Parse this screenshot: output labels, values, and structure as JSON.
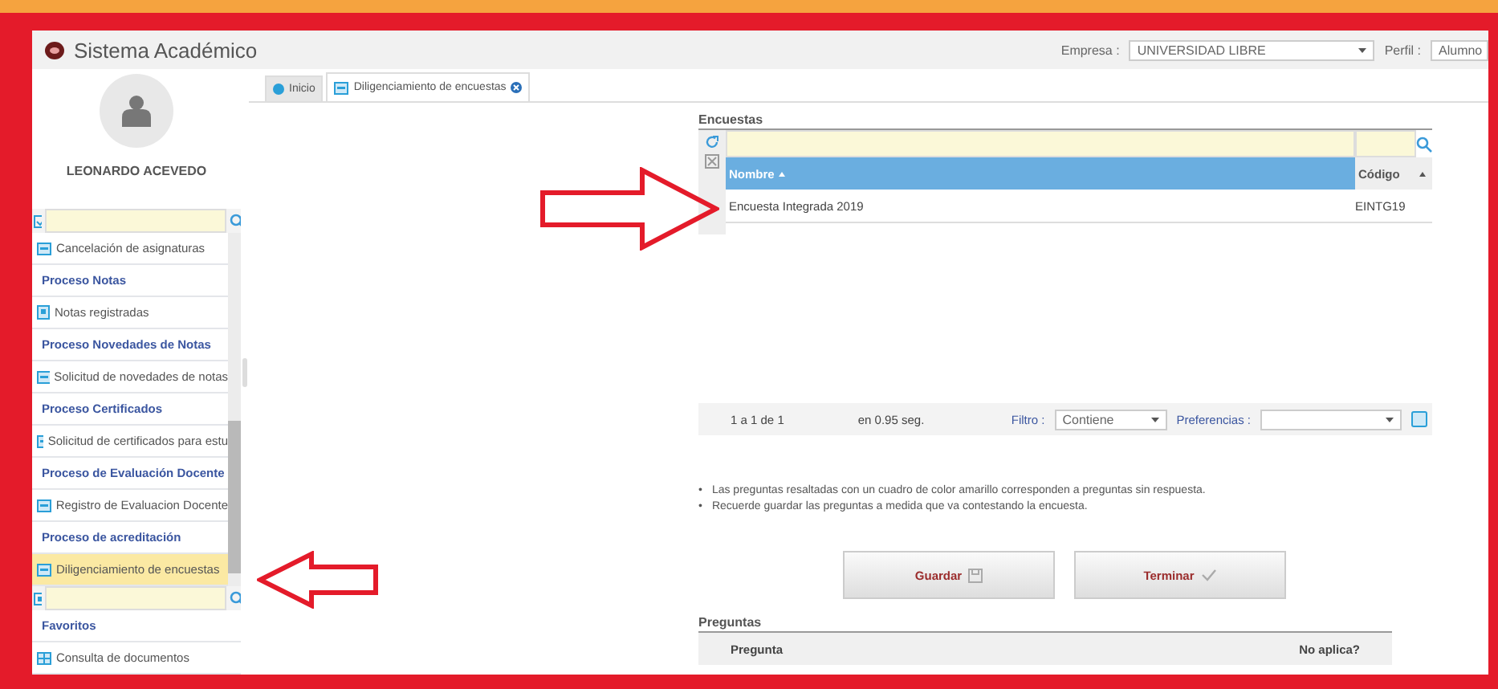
{
  "header": {
    "title": "Sistema Académico",
    "empresa_label": "Empresa :",
    "empresa_value": "UNIVERSIDAD LIBRE",
    "perfil_label": "Perfil :",
    "perfil_value": "Alumno"
  },
  "user": {
    "name": "LEONARDO ACEVEDO"
  },
  "menu": {
    "items": [
      {
        "label": "Cancelación de asignaturas",
        "kind": "link",
        "selected": false
      },
      {
        "label": "Proceso Notas",
        "kind": "section",
        "selected": false
      },
      {
        "label": "Notas registradas",
        "kind": "report",
        "selected": false
      },
      {
        "label": "Proceso Novedades de Notas",
        "kind": "section",
        "selected": false
      },
      {
        "label": "Solicitud de novedades de notas",
        "kind": "link",
        "selected": false
      },
      {
        "label": "Proceso Certificados",
        "kind": "section",
        "selected": false
      },
      {
        "label": "Solicitud de certificados para estu",
        "kind": "link",
        "selected": false
      },
      {
        "label": "Proceso de Evaluación Docente",
        "kind": "section",
        "selected": false
      },
      {
        "label": "Registro de Evaluacion Docente",
        "kind": "link",
        "selected": false
      },
      {
        "label": "Proceso de acreditación",
        "kind": "section",
        "selected": false
      },
      {
        "label": "Diligenciamiento de encuestas",
        "kind": "link",
        "selected": true
      }
    ]
  },
  "favorites": {
    "items": [
      {
        "label": "Favoritos",
        "kind": "section",
        "selected": false
      },
      {
        "label": "Consulta de documentos",
        "kind": "grid",
        "selected": false
      }
    ]
  },
  "tabs": [
    {
      "label": "Inicio",
      "kind": "home",
      "selected": false
    },
    {
      "label": "Diligenciamiento de encuestas",
      "kind": "form",
      "selected": true
    }
  ],
  "encuestas": {
    "title": "Encuestas",
    "columns": [
      {
        "label": "Nombre",
        "sorted": true
      },
      {
        "label": "Código",
        "sorted": false
      }
    ],
    "rows": [
      [
        "Encuesta Integrada 2019",
        "EINTG19"
      ]
    ],
    "pager": {
      "range": "1 a 1 de 1",
      "time": "en 0.95 seg.",
      "filter_label": "Filtro :",
      "filter_value": "Contiene",
      "prefs_label": "Preferencias :"
    }
  },
  "notes": [
    {
      "marker": "•",
      "text": "Las preguntas resaltadas con un cuadro de color amarillo corresponden a preguntas sin respuesta."
    },
    {
      "marker": "•",
      "text": "Recuerde guardar las preguntas a medida que va contestando la encuesta."
    }
  ],
  "buttons": [
    {
      "label": "Guardar",
      "kind": "save"
    },
    {
      "label": "Terminar",
      "kind": "finish"
    }
  ],
  "preguntas": {
    "title": "Preguntas",
    "columns": [
      "Pregunta",
      "No aplica?"
    ]
  }
}
